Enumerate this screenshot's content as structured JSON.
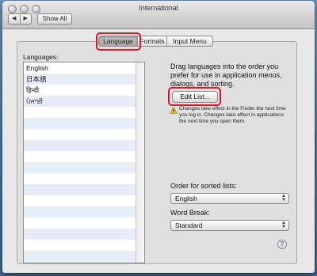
{
  "window": {
    "title": "International",
    "back_icon": "◀",
    "forward_icon": "▶",
    "show_all_label": "Show All"
  },
  "tabs": [
    {
      "label": "Language",
      "active": true
    },
    {
      "label": "Formats",
      "active": false
    },
    {
      "label": "Input Menu",
      "active": false
    }
  ],
  "languages": {
    "label": "Languages:",
    "items": [
      "English",
      "日本語",
      "हिन्दी",
      "ਪੰਜਾਬੀ"
    ]
  },
  "instructions": "Drag languages into the order you prefer for use in application menus, dialogs, and sorting.",
  "edit_list_label": "Edit List...",
  "note": "Changes take effect in the Finder the next time you log in. Changes take effect in applications the next time you open them.",
  "order": {
    "label": "Order for sorted lists:",
    "value": "English"
  },
  "word_break": {
    "label": "Word Break:",
    "value": "Standard"
  },
  "help_label": "?",
  "colors": {
    "highlight": "#e0112a",
    "warning": "#f0c419"
  }
}
